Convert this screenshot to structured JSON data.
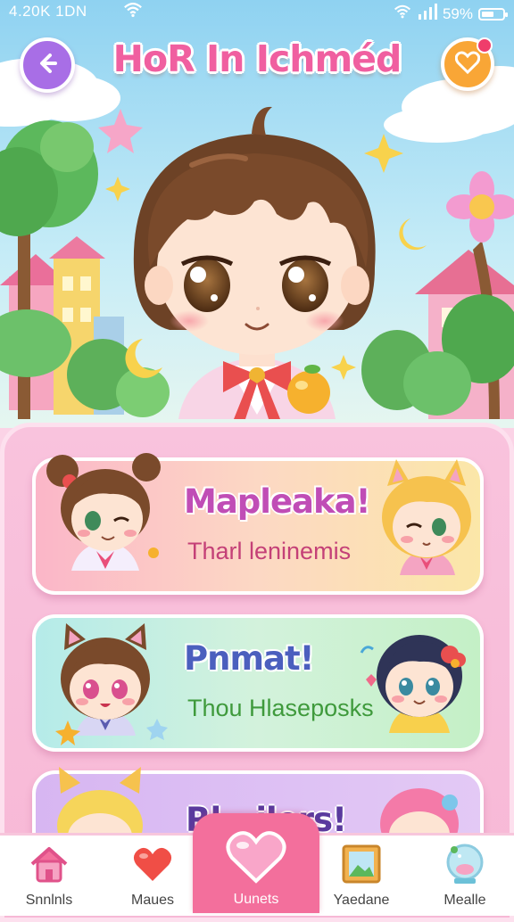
{
  "status_bar": {
    "time": "4.20K 1DN",
    "battery": "59%",
    "battery_level": 0.59
  },
  "header": {
    "title": "HoR In Ichméd"
  },
  "cards": [
    {
      "title": "Mapleaka!",
      "subtitle": "Tharl leninemis"
    },
    {
      "title": "Pnmat!",
      "subtitle": "Thou Hlaseposks"
    },
    {
      "title": "Rl...ilers!"
    }
  ],
  "nav": {
    "items": [
      {
        "label": "Snnlnls",
        "icon": "home-icon"
      },
      {
        "label": "Maues",
        "icon": "heart-icon"
      },
      {
        "label": "Uunets",
        "icon": "heart-icon"
      },
      {
        "label": "Yaedane",
        "icon": "picture-frame-icon"
      },
      {
        "label": "Mealle",
        "icon": "snow-globe-icon"
      }
    ],
    "active_index": 2
  },
  "colors": {
    "accent": "#f36f9c",
    "panel": "#f9c3dd",
    "back_button": "#a86ee6",
    "notif_button": "#f9a636"
  }
}
